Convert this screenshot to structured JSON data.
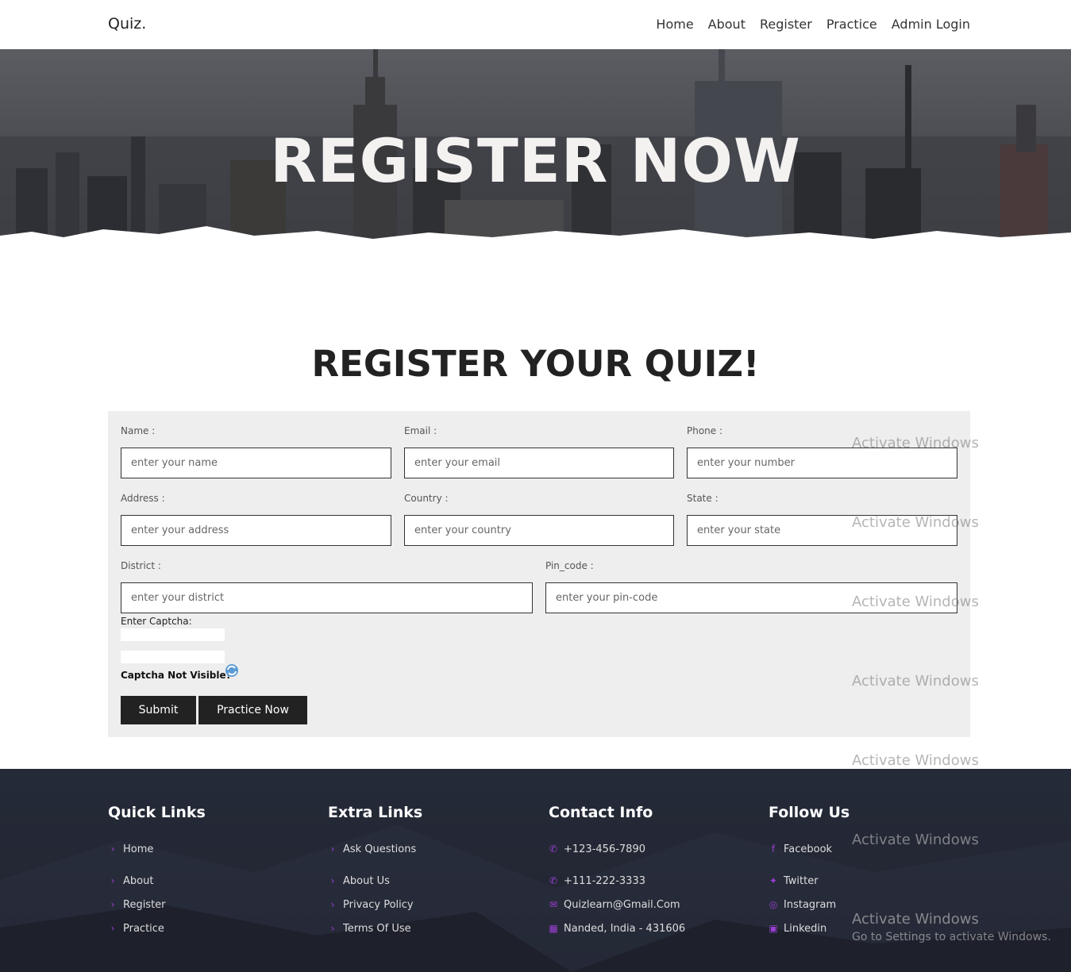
{
  "header": {
    "logo": "Quiz.",
    "nav": [
      "Home",
      "About",
      "Register",
      "Practice",
      "Admin Login"
    ]
  },
  "hero": {
    "title": "REGISTER NOW"
  },
  "form": {
    "title": "REGISTER YOUR QUIZ!",
    "fields": {
      "name": {
        "label": "Name :",
        "placeholder": "enter your name"
      },
      "email": {
        "label": "Email :",
        "placeholder": "enter your email"
      },
      "phone": {
        "label": "Phone :",
        "placeholder": "enter your number"
      },
      "address": {
        "label": "Address :",
        "placeholder": "enter your address"
      },
      "country": {
        "label": "Country :",
        "placeholder": "enter your country"
      },
      "state": {
        "label": "State :",
        "placeholder": "enter your state"
      },
      "district": {
        "label": "District :",
        "placeholder": "enter your district"
      },
      "pincode": {
        "label": "Pin_code :",
        "placeholder": "enter your pin-code"
      }
    },
    "captcha_label": "Enter Captcha:",
    "captcha_help": "Captcha Not Visible?",
    "submit_label": "Submit",
    "practice_label": "Practice Now"
  },
  "footer": {
    "quick": {
      "title": "Quick Links",
      "items": [
        "Home",
        "About",
        "Register",
        "Practice"
      ]
    },
    "extra": {
      "title": "Extra Links",
      "items": [
        "Ask Questions",
        "About Us",
        "Privacy Policy",
        "Terms Of Use"
      ]
    },
    "contact": {
      "title": "Contact Info",
      "items": [
        "+123-456-7890",
        "+111-222-3333",
        "Quizlearn@Gmail.Com",
        "Nanded, India - 431606"
      ]
    },
    "follow": {
      "title": "Follow Us",
      "items": [
        "Facebook",
        "Twitter",
        "Instagram",
        "Linkedin"
      ]
    }
  },
  "watermark": {
    "title": "Activate Windows",
    "subtitle": "Go to Settings to activate Windows."
  },
  "colors": {
    "accent": "#9b3fd6",
    "button": "#222222",
    "footer_bg": "#252a38",
    "form_bg": "#eeeeee"
  }
}
